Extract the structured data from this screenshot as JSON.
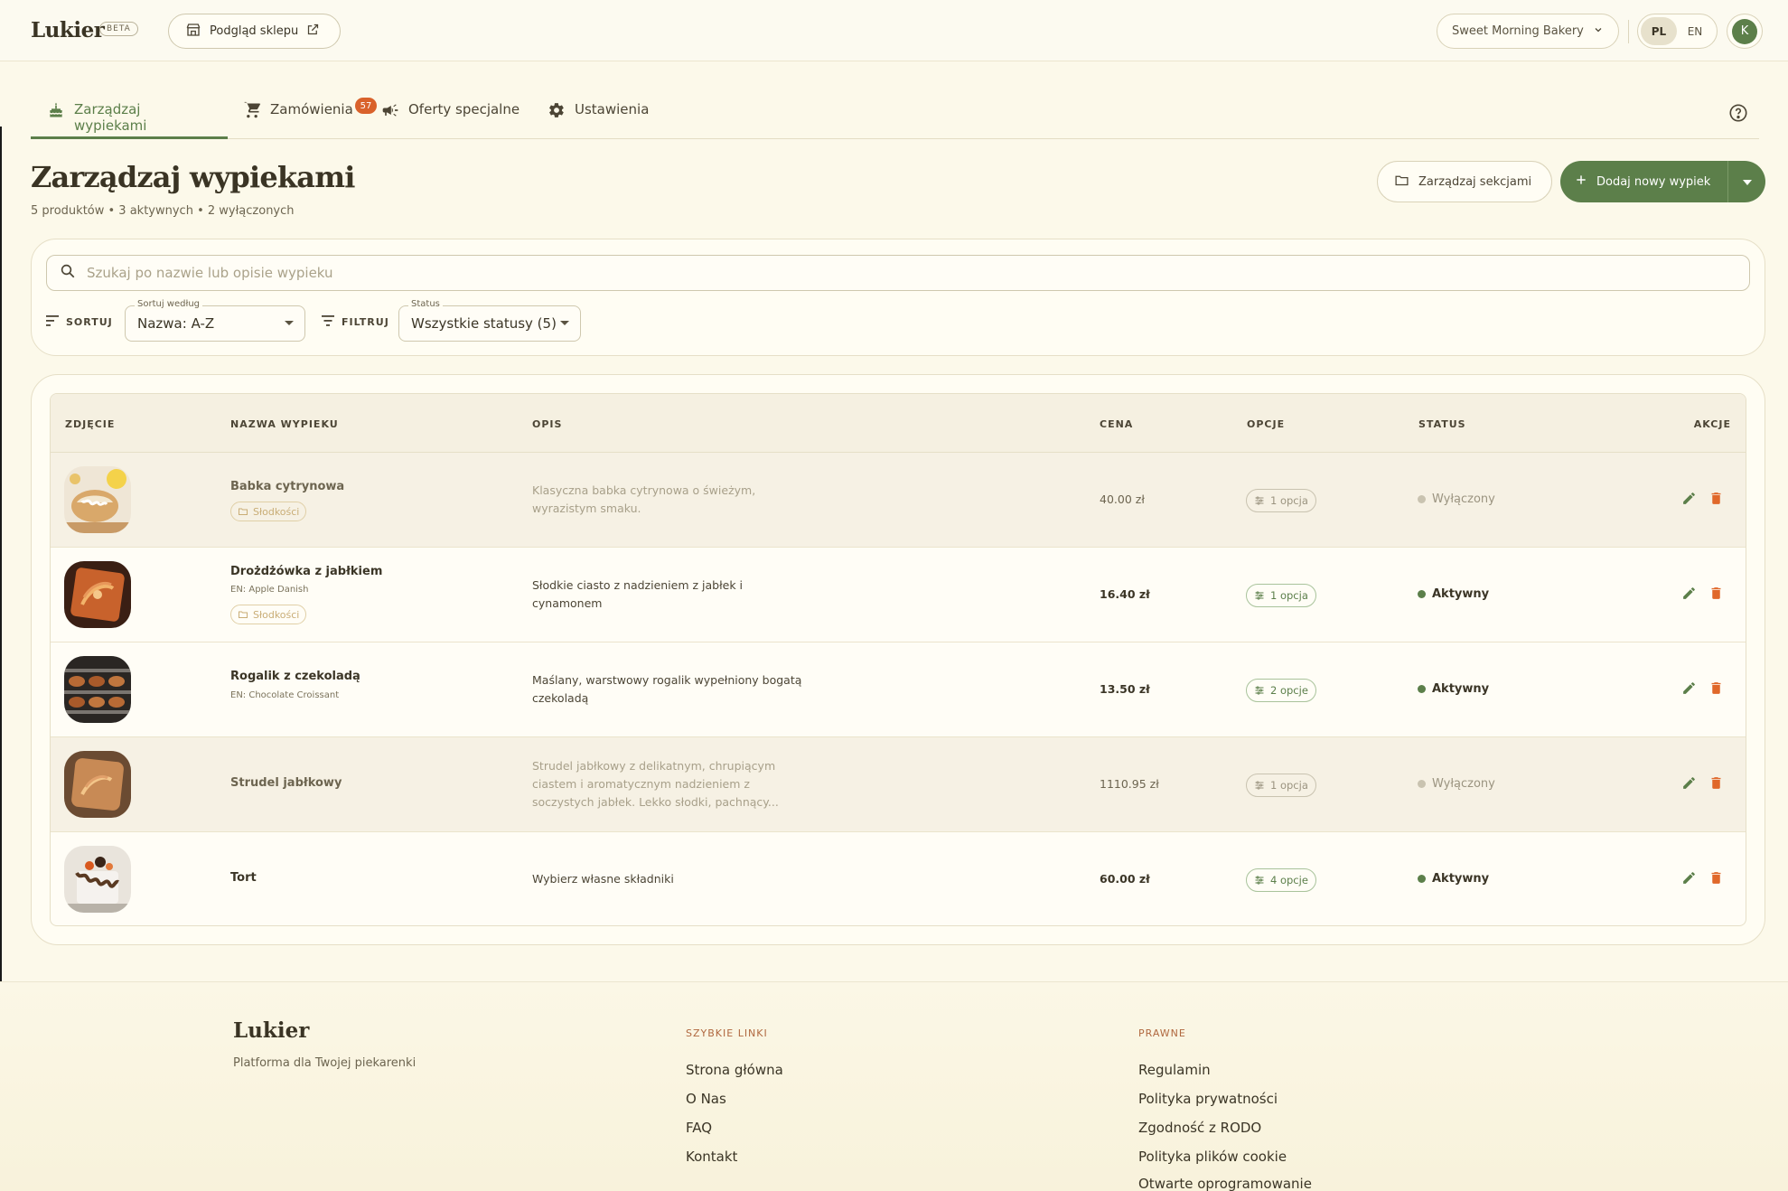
{
  "header": {
    "brand": "Lukier",
    "beta": "BETA",
    "preview_label": "Podgląd sklepu",
    "bakery": "Sweet Morning Bakery",
    "lang_pl": "PL",
    "lang_en": "EN",
    "avatar_initial": "K"
  },
  "tabs": [
    {
      "label": "Zarządzaj wypiekami",
      "icon": "cake-icon",
      "active": true
    },
    {
      "label": "Zamówienia",
      "icon": "cart-icon",
      "badge": "57"
    },
    {
      "label": "Oferty specjalne",
      "icon": "megaphone-icon"
    },
    {
      "label": "Ustawienia",
      "icon": "gear-icon"
    }
  ],
  "page": {
    "title": "Zarządzaj wypiekami",
    "subtitle": "5 produktów • 3 aktywnych • 2 wyłączonych",
    "sections_button": "Zarządzaj sekcjami",
    "add_button": "Dodaj nowy wypiek"
  },
  "filters": {
    "search_placeholder": "Szukaj po nazwie lub opisie wypieku",
    "sort_label": "SORTUJ",
    "sort_legend": "Sortuj według",
    "sort_value": "Nazwa: A-Z",
    "filter_label": "FILTRUJ",
    "status_legend": "Status",
    "status_value": "Wszystkie statusy (5)"
  },
  "table": {
    "headers": [
      "ZDJĘCIE",
      "NAZWA WYPIEKU",
      "OPIS",
      "CENA",
      "OPCJE",
      "STATUS",
      "AKCJE"
    ],
    "rows": [
      {
        "name": "Babka cytrynowa",
        "name_en": "",
        "category": "Słodkości",
        "desc1": "Klasyczna babka cytrynowa o świeżym,",
        "desc2": "wyrazistym smaku.",
        "desc3": "",
        "price": "40.00 zł",
        "options": "1 opcja",
        "status": "Wyłączony",
        "active": false
      },
      {
        "name": "Drożdżówka z jabłkiem",
        "name_en": "EN: Apple Danish",
        "category": "Słodkości",
        "desc1": "Słodkie ciasto z nadzieniem z jabłek i",
        "desc2": "cynamonem",
        "desc3": "",
        "price": "16.40 zł",
        "options": "1 opcja",
        "status": "Aktywny",
        "active": true
      },
      {
        "name": "Rogalik z czekoladą",
        "name_en": "EN: Chocolate Croissant",
        "category": "",
        "desc1": "Maślany, warstwowy rogalik wypełniony bogatą",
        "desc2": "czekoladą",
        "desc3": "",
        "price": "13.50 zł",
        "options": "2 opcje",
        "status": "Aktywny",
        "active": true
      },
      {
        "name": "Strudel jabłkowy",
        "name_en": "",
        "category": "",
        "desc1": "Strudel jabłkowy z delikatnym, chrupiącym",
        "desc2": "ciastem i aromatycznym nadzieniem z",
        "desc3": "soczystych jabłek. Lekko słodki, pachnący...",
        "price": "1110.95 zł",
        "options": "1 opcja",
        "status": "Wyłączony",
        "active": false
      },
      {
        "name": "Tort",
        "name_en": "",
        "category": "",
        "desc1": "Wybierz własne składniki",
        "desc2": "",
        "desc3": "",
        "price": "60.00 zł",
        "options": "4 opcje",
        "status": "Aktywny",
        "active": true
      }
    ]
  },
  "footer": {
    "brand": "Lukier",
    "tagline": "Platforma dla Twojej piekarenki",
    "quick_links_title": "SZYBKIE LINKI",
    "quick_links": [
      "Strona główna",
      "O Nas",
      "FAQ",
      "Kontakt"
    ],
    "legal_title": "PRAWNE",
    "legal_links": [
      "Regulamin",
      "Polityka prywatności",
      "Zgodność z RODO",
      "Polityka plików cookie",
      "Otwarte oprogramowanie"
    ]
  },
  "colors": {
    "accent": "#5c7f4a",
    "badge": "#d9622b",
    "delete": "#e0682a",
    "background": "#fcf9ea"
  }
}
